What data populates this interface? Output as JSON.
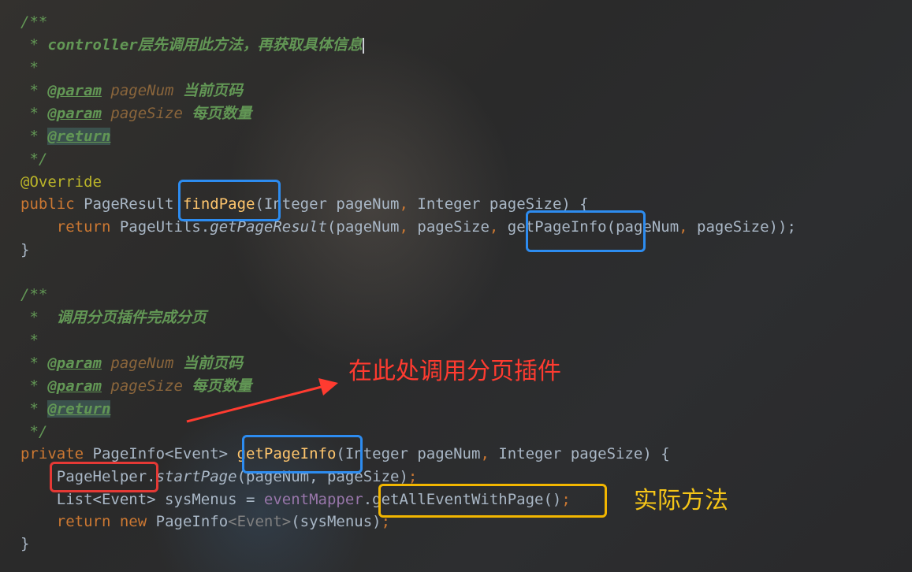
{
  "colors": {
    "comment": "#629755",
    "keyword": "#cc7832",
    "annotation": "#bbb529",
    "text": "#a9b7c6",
    "method": "#ffc66d",
    "field": "#9876aa",
    "box_blue": "#2d8cf0",
    "box_red": "#e53935",
    "box_yellow": "#f2b600",
    "note_red": "#ff3b30",
    "note_yellow": "#f5c518"
  },
  "doc1": {
    "open": "/**",
    "star": " *",
    "summary_star": " * ",
    "summary": "controller层先调用此方法，再获取具体信息",
    "param_star": " * ",
    "param_tag": "@param",
    "param1_name": "pageNum",
    "param1_desc": "当前页码",
    "param2_name": "pageSize",
    "param2_desc": "每页数量",
    "return_tag": "@return",
    "close": " */"
  },
  "method1": {
    "annotation": "@Override",
    "modifier": "public",
    "return_type": "PageResult",
    "name": "findPage",
    "params_open": "(Integer pageNum",
    "comma": ",",
    "params_rest": " Integer pageSize) {",
    "return_kw": "return",
    "call_class": "PageUtils.",
    "call_static": "getPageResult",
    "call_args": "(pageNum",
    "call_args2": " pageSize",
    "inner_call": "getPageInfo",
    "inner_args": "(pageNum",
    "inner_args2": " pageSize));",
    "semicolon": ";",
    "close": "}"
  },
  "doc2": {
    "open": "/**",
    "star": " *",
    "summary_star": " *  ",
    "summary": "调用分页插件完成分页",
    "param_star": " * ",
    "param_tag": "@param",
    "param1_name": "pageNum",
    "param1_desc": "当前页码",
    "param2_name": "pageSize",
    "param2_desc": "每页数量",
    "return_tag": "@return",
    "close": " */"
  },
  "method2": {
    "modifier": "private",
    "return_type": "PageInfo<Event> ",
    "name": "getPageInfo",
    "params_open": "(Integer pageNum",
    "comma": ",",
    "params_rest": " Integer pageSize) {",
    "helper_class": "PageHelper",
    "helper_dot": ".",
    "helper_method": "startPage",
    "helper_args": "(pageNum, pageSize)",
    "semicolon": ";",
    "list_decl": "List<Event> sysMenus = ",
    "mapper_field": "eventMapper",
    "mapper_call": ".getAllEventWithPage()",
    "return_kw": "return",
    "new_kw": "new",
    "new_type": " PageInfo",
    "generic": "<Event>",
    "new_args": "(sysMenus)",
    "close": "}"
  },
  "annotations": {
    "red_note": "在此处调用分页插件",
    "yellow_note": "实际方法"
  }
}
